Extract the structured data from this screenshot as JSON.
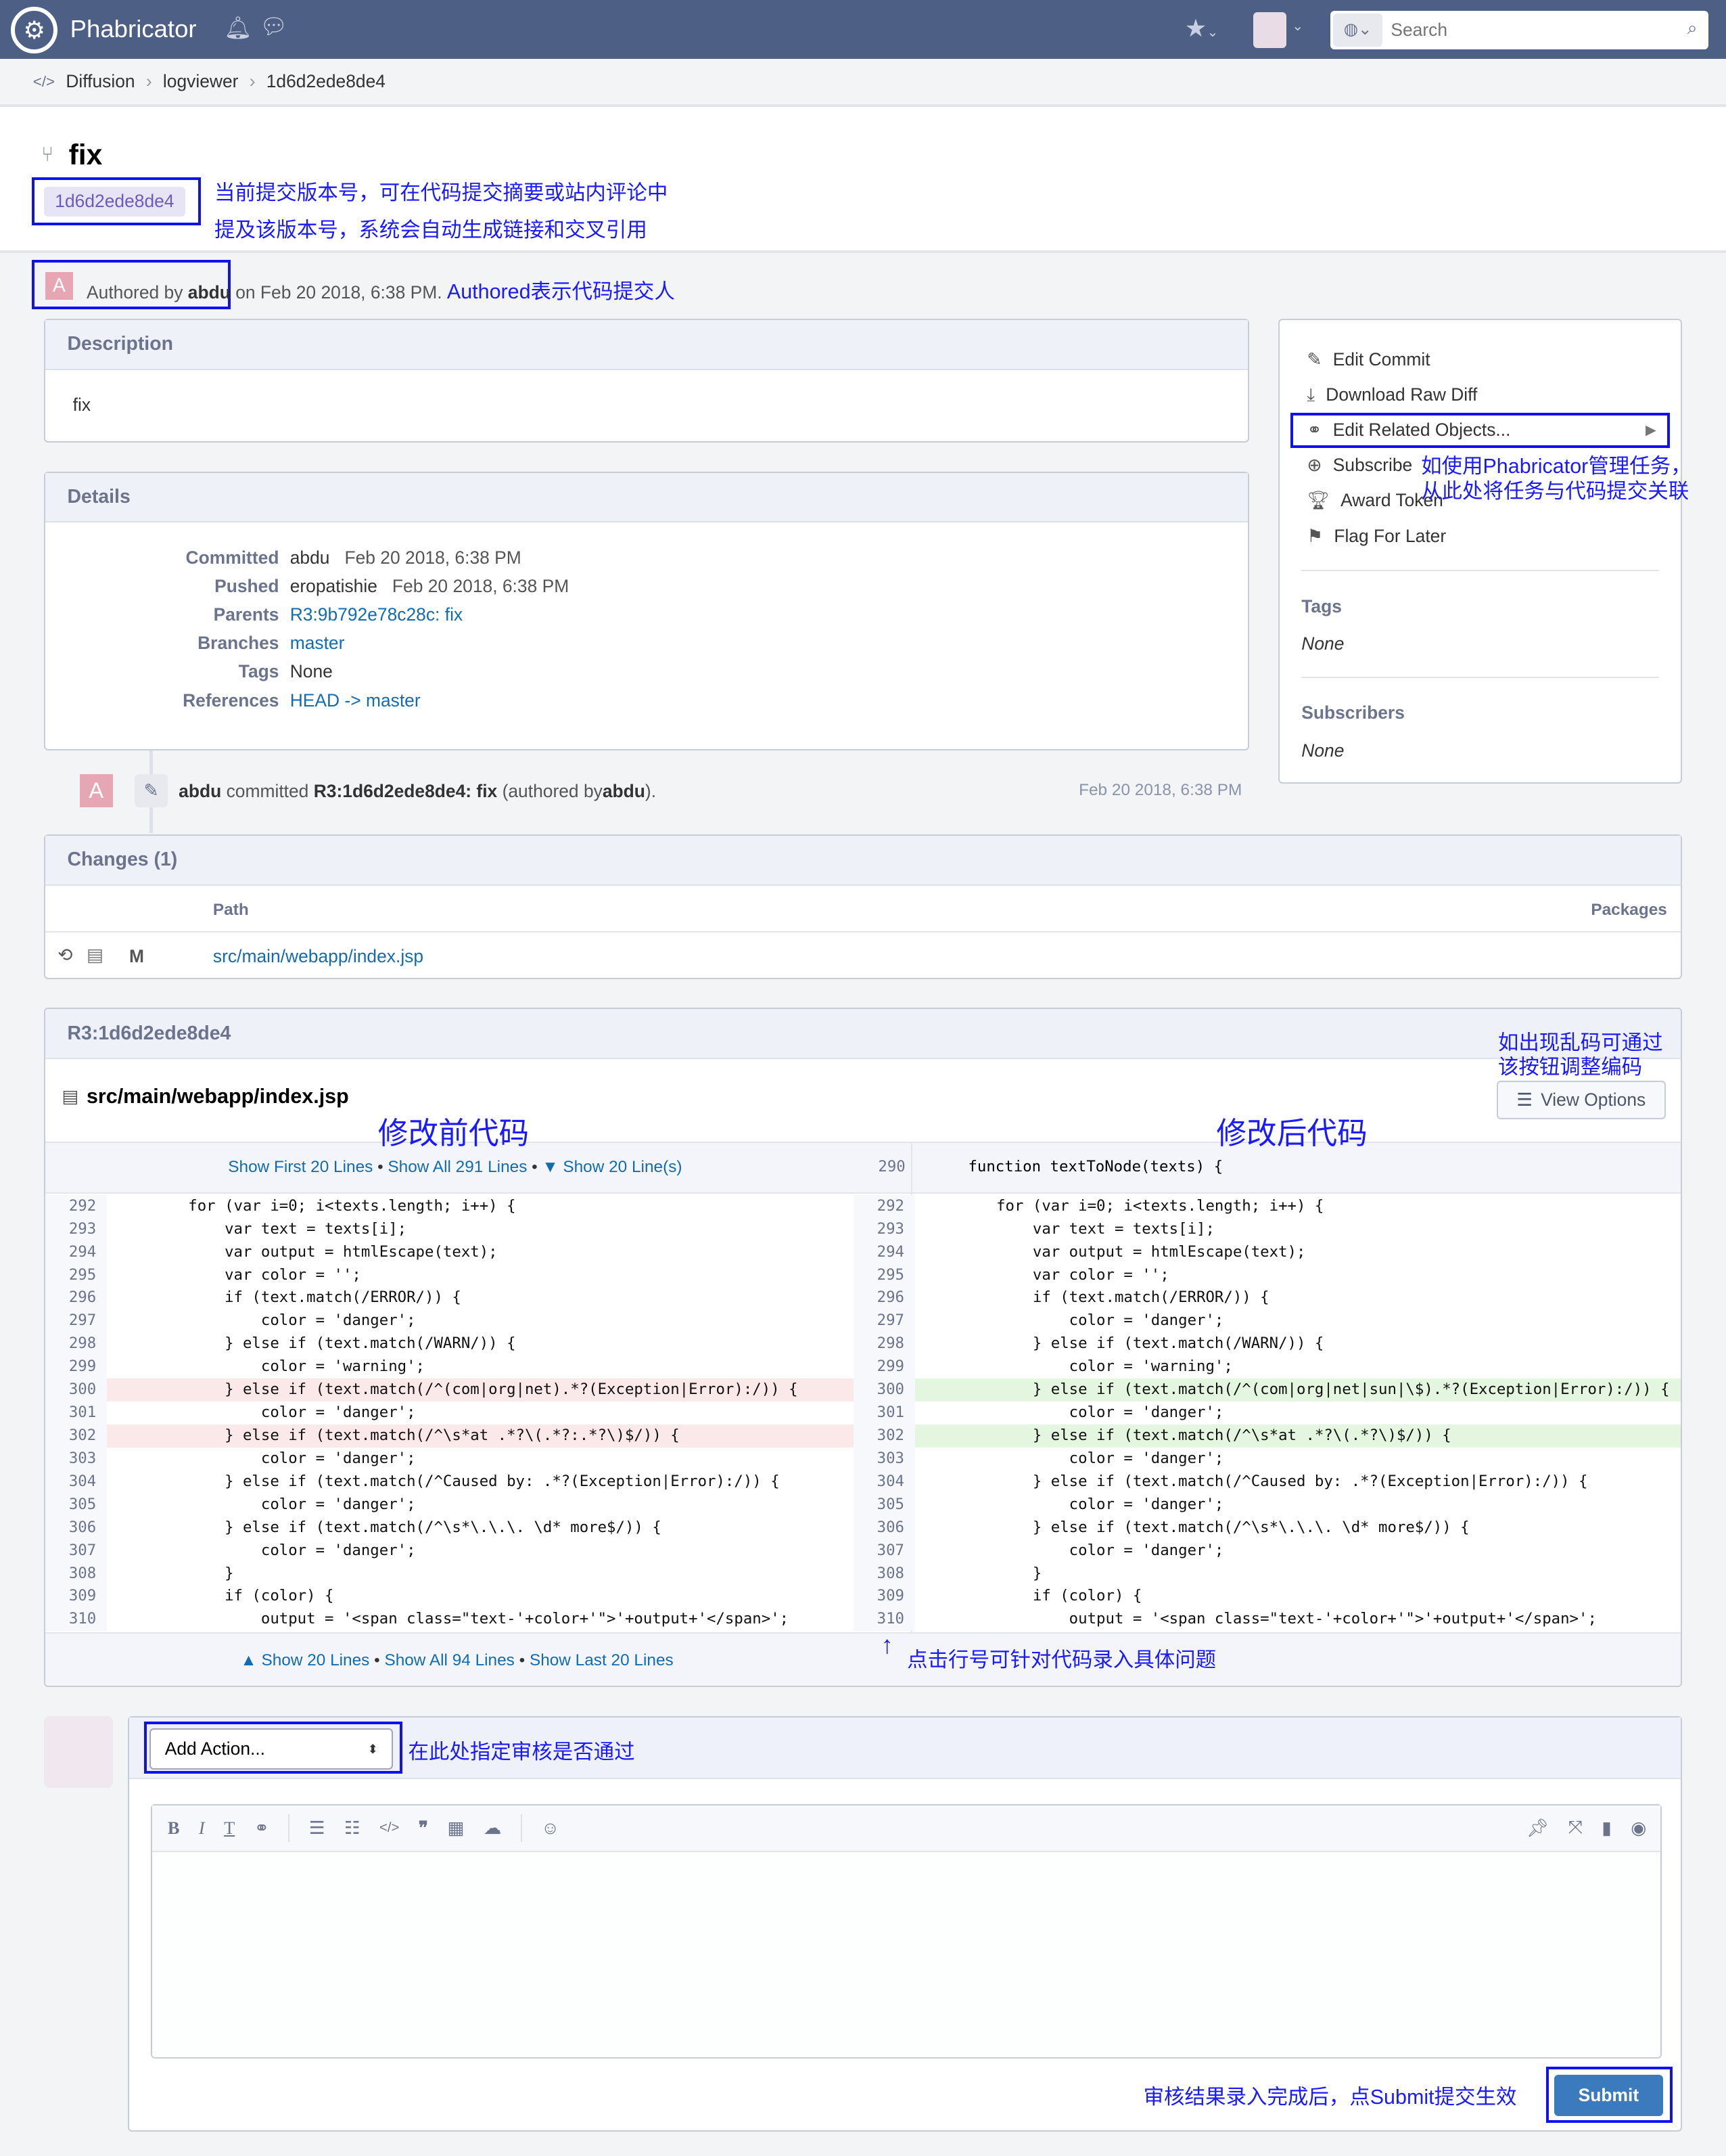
{
  "header": {
    "app_name": "Phabricator",
    "search_placeholder": "Search"
  },
  "breadcrumbs": [
    "Diffusion",
    "logviewer",
    "1d6d2ede8de4"
  ],
  "commit": {
    "title": "fix",
    "hash_tag": "1d6d2ede8de4",
    "author_prefix": "Authored by",
    "author": "abdu",
    "author_suffix": "on Feb 20 2018, 6:38 PM.",
    "avatar_letter": "A"
  },
  "annotations": {
    "hash_line1": "当前提交版本号，可在代码提交摘要或站内评论中",
    "hash_line2": "提及该版本号，系统会自动生成链接和交叉引用",
    "authored": "Authored表示代码提交人",
    "related_line1": "如使用Phabricator管理任务，",
    "related_line2": "从此处将任务与代码提交关联",
    "encoding_line1": "如出现乱码可通过",
    "encoding_line2": "该按钮调整编码",
    "before": "修改前代码",
    "after": "修改后代码",
    "line_number": "点击行号可针对代码录入具体问题",
    "action": "在此处指定审核是否通过",
    "submit": "审核结果录入完成后，点Submit提交生效"
  },
  "description": {
    "title": "Description",
    "body": "fix"
  },
  "details": {
    "title": "Details",
    "rows": [
      {
        "k": "Committed",
        "v": "abdu",
        "d": "Feb 20 2018, 6:38 PM"
      },
      {
        "k": "Pushed",
        "v": "eropatishie",
        "d": "Feb 20 2018, 6:38 PM"
      },
      {
        "k": "Parents",
        "link": "R3:9b792e78c28c: fix"
      },
      {
        "k": "Branches",
        "link": "master"
      },
      {
        "k": "Tags",
        "v": "None"
      },
      {
        "k": "References",
        "link": "HEAD -> master"
      }
    ]
  },
  "actions": [
    {
      "icon": "pencil-icon",
      "label": "Edit Commit"
    },
    {
      "icon": "download-icon",
      "label": "Download Raw Diff"
    },
    {
      "icon": "link-icon",
      "label": "Edit Related Objects..."
    },
    {
      "icon": "plus-circle-icon",
      "label": "Subscribe"
    },
    {
      "icon": "trophy-icon",
      "label": "Award Token"
    },
    {
      "icon": "flag-icon",
      "label": "Flag For Later"
    }
  ],
  "sidebar": {
    "tags_label": "Tags",
    "tags_value": "None",
    "subs_label": "Subscribers",
    "subs_value": "None"
  },
  "timeline": {
    "author": "abdu",
    "verb": "committed",
    "ref": "R3:1d6d2ede8de4: fix",
    "paren_pre": "(authored by",
    "paren_author": "abdu",
    "paren_post": ").",
    "date": "Feb 20 2018, 6:38 PM"
  },
  "changes": {
    "title": "Changes (1)",
    "col_path": "Path",
    "col_packages": "Packages",
    "files": [
      {
        "status": "M",
        "path": "src/main/webapp/index.jsp"
      }
    ]
  },
  "diff": {
    "title": "R3:1d6d2ede8de4",
    "file": "src/main/webapp/index.jsp",
    "view_options": "View Options",
    "show_top": [
      "Show First 20 Lines",
      "Show All 291 Lines",
      "▼ Show 20 Line(s)"
    ],
    "show_bottom": [
      "▲ Show 20 Lines",
      "Show All 94 Lines",
      "Show Last 20 Lines"
    ],
    "context_line_number": "290",
    "context_line": "    function textToNode(texts) {",
    "left": [
      {
        "n": "292",
        "t": "        for (var i=0; i<texts.length; i++) {"
      },
      {
        "n": "293",
        "t": "            var text = texts[i];"
      },
      {
        "n": "294",
        "t": "            var output = htmlEscape(text);"
      },
      {
        "n": "295",
        "t": "            var color = '';"
      },
      {
        "n": "296",
        "t": "            if (text.match(/ERROR/)) {"
      },
      {
        "n": "297",
        "t": "                color = 'danger';"
      },
      {
        "n": "298",
        "t": "            } else if (text.match(/WARN/)) {"
      },
      {
        "n": "299",
        "t": "                color = 'warning';"
      },
      {
        "n": "300",
        "t": "            } else if (text.match(/^(com|org|net).*?(Exception|Error):/)) {",
        "c": "del"
      },
      {
        "n": "301",
        "t": "                color = 'danger';"
      },
      {
        "n": "302",
        "t": "            } else if (text.match(/^\\s*at .*?\\(.*?:.*?\\)$/)) {",
        "c": "del"
      },
      {
        "n": "303",
        "t": "                color = 'danger';"
      },
      {
        "n": "304",
        "t": "            } else if (text.match(/^Caused by: .*?(Exception|Error):/)) {"
      },
      {
        "n": "305",
        "t": "                color = 'danger';"
      },
      {
        "n": "306",
        "t": "            } else if (text.match(/^\\s*\\.\\.\\. \\d* more$/)) {"
      },
      {
        "n": "307",
        "t": "                color = 'danger';"
      },
      {
        "n": "308",
        "t": "            }"
      },
      {
        "n": "309",
        "t": "            if (color) {"
      },
      {
        "n": "310",
        "t": "                output = '<span class=\"text-'+color+'\">'+output+'</span>';"
      }
    ],
    "right": [
      {
        "n": "292",
        "t": "        for (var i=0; i<texts.length; i++) {"
      },
      {
        "n": "293",
        "t": "            var text = texts[i];"
      },
      {
        "n": "294",
        "t": "            var output = htmlEscape(text);"
      },
      {
        "n": "295",
        "t": "            var color = '';"
      },
      {
        "n": "296",
        "t": "            if (text.match(/ERROR/)) {"
      },
      {
        "n": "297",
        "t": "                color = 'danger';"
      },
      {
        "n": "298",
        "t": "            } else if (text.match(/WARN/)) {"
      },
      {
        "n": "299",
        "t": "                color = 'warning';"
      },
      {
        "n": "300",
        "t": "            } else if (text.match(/^(com|org|net|sun|\\$).*?(Exception|Error):/)) {",
        "c": "add"
      },
      {
        "n": "301",
        "t": "                color = 'danger';"
      },
      {
        "n": "302",
        "t": "            } else if (text.match(/^\\s*at .*?\\(.*?\\)$/)) {",
        "c": "add"
      },
      {
        "n": "303",
        "t": "                color = 'danger';"
      },
      {
        "n": "304",
        "t": "            } else if (text.match(/^Caused by: .*?(Exception|Error):/)) {"
      },
      {
        "n": "305",
        "t": "                color = 'danger';"
      },
      {
        "n": "306",
        "t": "            } else if (text.match(/^\\s*\\.\\.\\. \\d* more$/)) {"
      },
      {
        "n": "307",
        "t": "                color = 'danger';"
      },
      {
        "n": "308",
        "t": "            }"
      },
      {
        "n": "309",
        "t": "            if (color) {"
      },
      {
        "n": "310",
        "t": "                output = '<span class=\"text-'+color+'\">'+output+'</span>';"
      }
    ]
  },
  "comment": {
    "action_select": "Add Action...",
    "submit": "Submit"
  },
  "colors": {
    "topbar": "#4e5f85",
    "link": "#136cb2",
    "annotation": "#1a1aff",
    "deleted": "#fbe9ea",
    "added": "#e4f6df",
    "submit": "#3b7bbd"
  }
}
